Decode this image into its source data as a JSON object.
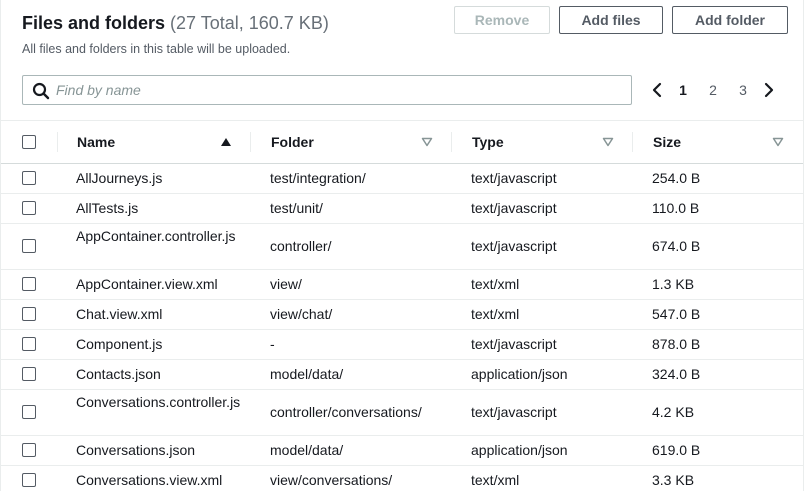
{
  "header": {
    "title": "Files and folders",
    "counter": "(27 Total, 160.7 KB)",
    "description": "All files and folders in this table will be uploaded."
  },
  "actions": {
    "remove_label": "Remove",
    "add_files_label": "Add files",
    "add_folder_label": "Add folder"
  },
  "search": {
    "placeholder": "Find by name",
    "value": "",
    "icon": "search-icon"
  },
  "pagination": {
    "pages": [
      "1",
      "2",
      "3"
    ],
    "current": "1",
    "prev_icon": "chevron-left-icon",
    "next_icon": "chevron-right-icon"
  },
  "table": {
    "columns": [
      {
        "label": "Name",
        "sort": "ascending"
      },
      {
        "label": "Folder",
        "sort": "none"
      },
      {
        "label": "Type",
        "sort": "none"
      },
      {
        "label": "Size",
        "sort": "none"
      }
    ],
    "rows": [
      {
        "name": "AllJourneys.js",
        "folder": "test/integration/",
        "type": "text/javascript",
        "size": "254.0 B"
      },
      {
        "name": "AllTests.js",
        "folder": "test/unit/",
        "type": "text/javascript",
        "size": "110.0 B"
      },
      {
        "name": "AppContainer.controller.js",
        "folder": "controller/",
        "type": "text/javascript",
        "size": "674.0 B"
      },
      {
        "name": "AppContainer.view.xml",
        "folder": "view/",
        "type": "text/xml",
        "size": "1.3 KB"
      },
      {
        "name": "Chat.view.xml",
        "folder": "view/chat/",
        "type": "text/xml",
        "size": "547.0 B"
      },
      {
        "name": "Component.js",
        "folder": "-",
        "type": "text/javascript",
        "size": "878.0 B"
      },
      {
        "name": "Contacts.json",
        "folder": "model/data/",
        "type": "application/json",
        "size": "324.0 B"
      },
      {
        "name": "Conversations.controller.js",
        "folder": "controller/conversations/",
        "type": "text/javascript",
        "size": "4.2 KB"
      },
      {
        "name": "Conversations.json",
        "folder": "model/data/",
        "type": "application/json",
        "size": "619.0 B"
      },
      {
        "name": "Conversations.view.xml",
        "folder": "view/conversations/",
        "type": "text/xml",
        "size": "3.3 KB"
      }
    ]
  },
  "colors": {
    "text": "#16191f",
    "muted": "#545b64",
    "border": "#eaeded",
    "disabled": "#aab7b8"
  }
}
